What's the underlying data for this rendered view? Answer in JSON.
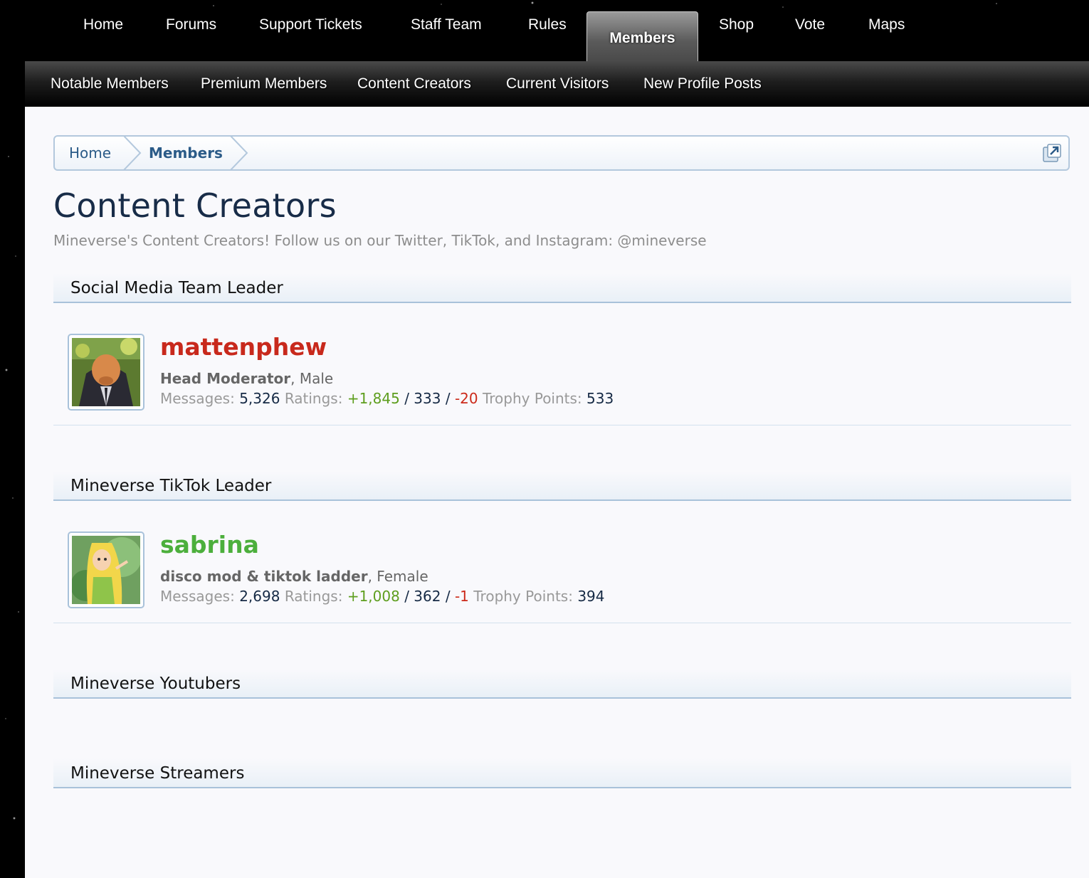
{
  "top_nav": [
    {
      "label": "Home",
      "active": false
    },
    {
      "label": "Forums",
      "active": false
    },
    {
      "label": "Support Tickets",
      "active": false
    },
    {
      "label": "Staff Team",
      "active": false
    },
    {
      "label": "Rules",
      "active": false
    },
    {
      "label": "Members",
      "active": true
    },
    {
      "label": "Shop",
      "active": false
    },
    {
      "label": "Vote",
      "active": false
    },
    {
      "label": "Maps",
      "active": false
    }
  ],
  "sub_nav": [
    {
      "label": "Notable Members"
    },
    {
      "label": "Premium Members"
    },
    {
      "label": "Content Creators"
    },
    {
      "label": "Current Visitors"
    },
    {
      "label": "New Profile Posts"
    }
  ],
  "breadcrumb": [
    {
      "label": "Home"
    },
    {
      "label": "Members"
    }
  ],
  "page": {
    "title": "Content Creators",
    "description": "Mineverse's Content Creators! Follow us on our Twitter, TikTok, and Instagram: @mineverse"
  },
  "stat_labels": {
    "messages": "Messages:",
    "ratings": "Ratings:",
    "trophy": "Trophy Points:",
    "sep": "/"
  },
  "sections": [
    {
      "title": "Social Media Team Leader",
      "members": [
        {
          "username": "mattenphew",
          "username_color": "#c8291c",
          "user_title": "Head Moderator",
          "gender": ", Male",
          "messages": "5,326",
          "ratings_pos": "+1,845",
          "ratings_neutral": "333",
          "ratings_neg": "-20",
          "trophy_points": "533"
        }
      ]
    },
    {
      "title": "Mineverse TikTok Leader",
      "members": [
        {
          "username": "sabrina",
          "username_color": "#4caf3c",
          "user_title": "disco mod & tiktok ladder",
          "gender": ", Female",
          "messages": "2,698",
          "ratings_pos": "+1,008",
          "ratings_neutral": "362",
          "ratings_neg": "-1",
          "trophy_points": "394"
        }
      ]
    },
    {
      "title": "Mineverse Youtubers",
      "members": []
    },
    {
      "title": "Mineverse Streamers",
      "members": []
    }
  ]
}
